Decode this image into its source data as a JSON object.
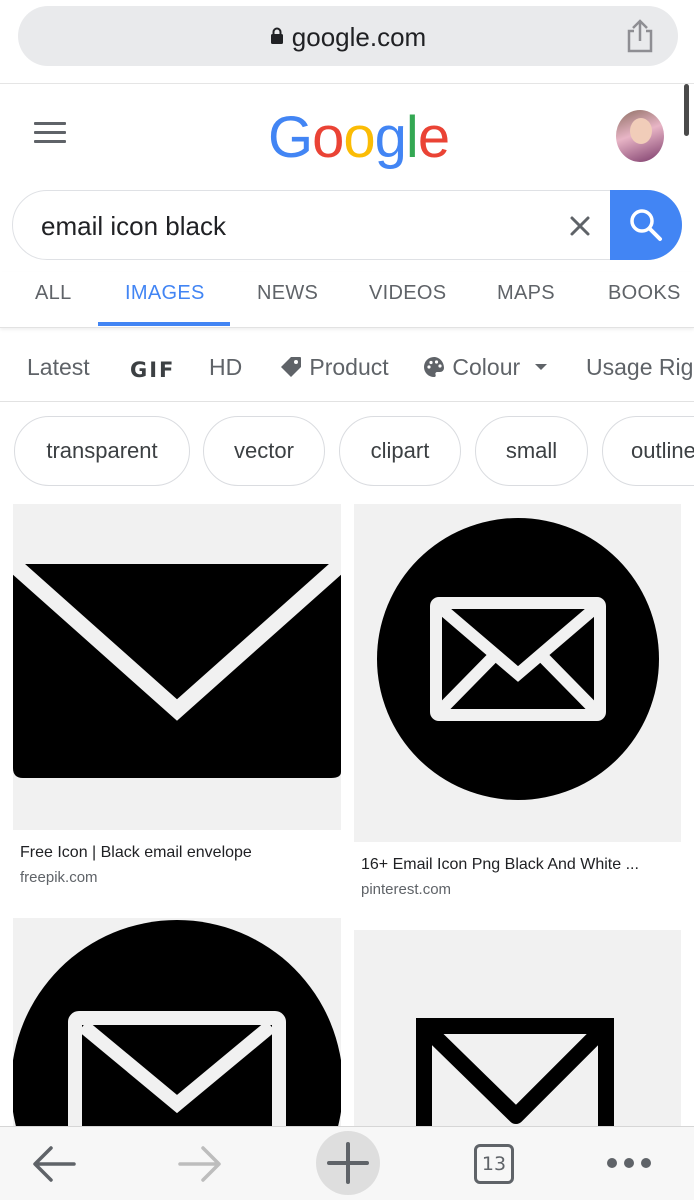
{
  "browser": {
    "url": "google.com",
    "icons": [
      "lock-icon",
      "share-icon"
    ]
  },
  "header": {
    "logo_letters": [
      {
        "ch": "G",
        "color": "#4285F4"
      },
      {
        "ch": "o",
        "color": "#EA4335"
      },
      {
        "ch": "o",
        "color": "#FBBC05"
      },
      {
        "ch": "g",
        "color": "#4285F4"
      },
      {
        "ch": "l",
        "color": "#34A853"
      },
      {
        "ch": "e",
        "color": "#EA4335"
      }
    ],
    "icons": [
      "hamburger-menu-icon",
      "avatar"
    ]
  },
  "search": {
    "query": "email icon black",
    "accent": "#4285F4"
  },
  "tabs": [
    {
      "label": "ALL"
    },
    {
      "label": "IMAGES",
      "active": true
    },
    {
      "label": "NEWS"
    },
    {
      "label": "VIDEOS"
    },
    {
      "label": "MAPS"
    },
    {
      "label": "BOOKS"
    }
  ],
  "filters": {
    "latest": "Latest",
    "gif": "GIF",
    "hd": "HD",
    "product": "Product",
    "colour": "Colour",
    "usage": "Usage Rig"
  },
  "chips": [
    "transparent",
    "vector",
    "clipart",
    "small",
    "outline"
  ],
  "results": [
    {
      "title": "Free Icon | Black email envelope",
      "site": "freepik.com",
      "icon": "envelope-icon"
    },
    {
      "title": "16+ Email Icon Png Black And White ...",
      "site": "pinterest.com",
      "icon": "envelope-circle-icon"
    },
    {
      "title": "",
      "site": "",
      "icon": "envelope-circle-icon"
    },
    {
      "title": "",
      "site": "",
      "icon": "envelope-outline-icon"
    }
  ],
  "toolbar": {
    "tab_count": "13",
    "icons": [
      "back-arrow-icon",
      "forward-arrow-icon",
      "new-tab-plus-icon",
      "tabs-icon",
      "more-dots-icon"
    ]
  }
}
